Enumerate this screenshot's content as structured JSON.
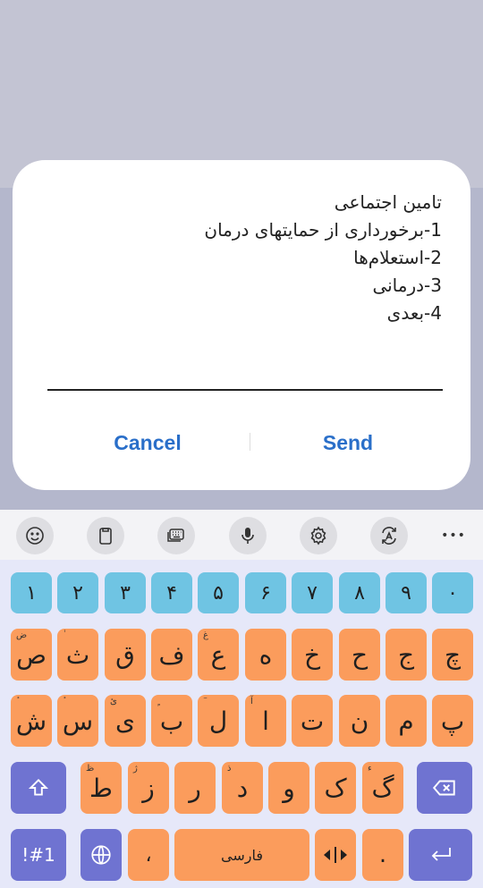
{
  "dialog": {
    "message_lines": [
      "تامین اجتماعی",
      "1-برخورداری از حمایتهای درمان",
      "2-استعلام‌ها",
      "3-درمانی",
      "4-بعدی"
    ],
    "cancel_label": "Cancel",
    "send_label": "Send"
  },
  "toolbar": {
    "icons": [
      "emoji-icon",
      "clipboard-icon",
      "keyboard-mode-icon",
      "microphone-icon",
      "settings-icon",
      "translate-icon",
      "more-icon"
    ],
    "more_label": "•••"
  },
  "keyboard": {
    "numbers": [
      "۱",
      "۲",
      "۳",
      "۴",
      "۵",
      "۶",
      "۷",
      "۸",
      "۹",
      "۰"
    ],
    "row1": [
      {
        "k": "ص",
        "h": "ض"
      },
      {
        "k": "ث",
        "h": "ٰ"
      },
      {
        "k": "ق",
        "h": ""
      },
      {
        "k": "ف",
        "h": ""
      },
      {
        "k": "ع",
        "h": "غ"
      },
      {
        "k": "ه",
        "h": ""
      },
      {
        "k": "خ",
        "h": ""
      },
      {
        "k": "ح",
        "h": ""
      },
      {
        "k": "ج",
        "h": ""
      },
      {
        "k": "چ",
        "h": ""
      }
    ],
    "row2": [
      {
        "k": "ش",
        "h": "ٔ"
      },
      {
        "k": "س",
        "h": "ٔ"
      },
      {
        "k": "ی",
        "h": "ئ"
      },
      {
        "k": "ب",
        "h": "ٍ"
      },
      {
        "k": "ل",
        "h": "ٓ"
      },
      {
        "k": "ا",
        "h": "آ"
      },
      {
        "k": "ت",
        "h": ""
      },
      {
        "k": "ن",
        "h": ""
      },
      {
        "k": "م",
        "h": ""
      },
      {
        "k": "پ",
        "h": ""
      }
    ],
    "row3": [
      {
        "k": "ط",
        "h": "ظ"
      },
      {
        "k": "ز",
        "h": "ژ"
      },
      {
        "k": "ر",
        "h": ""
      },
      {
        "k": "د",
        "h": "ذ"
      },
      {
        "k": "و",
        "h": ""
      },
      {
        "k": "ک",
        "h": ""
      },
      {
        "k": "گ",
        "h": "ء"
      }
    ],
    "symbols_label": "!#1",
    "comma_label": "،",
    "space_label": "فارسی",
    "period_label": "."
  },
  "colors": {
    "number_key": "#6fc4e3",
    "letter_key": "#fb9c5c",
    "function_key": "#6f73d1",
    "accent": "#2a6fc9"
  }
}
